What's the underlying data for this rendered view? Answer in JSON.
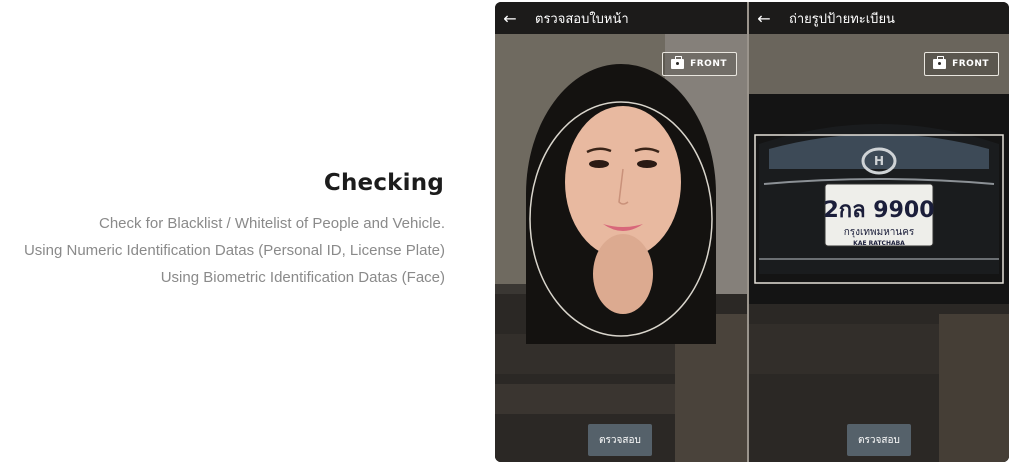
{
  "section": {
    "heading": "Checking",
    "lines": [
      "Check for Blacklist / Whitelist of People and Vehicle.",
      "Using Numeric Identification Datas (Personal ID, License Plate)",
      "Using Biometric Identification Datas (Face)"
    ]
  },
  "screens": [
    {
      "title": "ตรวจสอบใบหน้า",
      "back_icon": "arrow-left-icon",
      "camera_button_label": "FRONT",
      "action_button_label": "ตรวจสอบ"
    },
    {
      "title": "ถ่ายรูปป้ายทะเบียน",
      "back_icon": "arrow-left-icon",
      "camera_button_label": "FRONT",
      "action_button_label": "ตรวจสอบ",
      "plate_number": "2กล 9900",
      "plate_province": "กรุงเทพมหานคร",
      "plate_dealer": "KAE RATCHABA"
    }
  ],
  "colors": {
    "accent_button": "#55616a",
    "appbar": "#1c1b1a"
  }
}
